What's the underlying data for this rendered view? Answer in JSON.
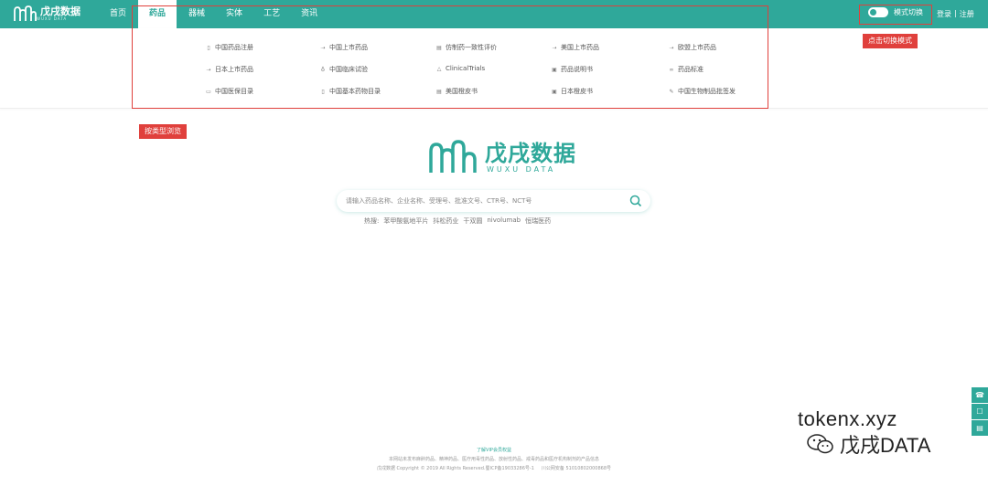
{
  "header": {
    "logo_text": "戊戌数据",
    "logo_sub": "WUXU DATA",
    "nav": [
      "首页",
      "药品",
      "器械",
      "实体",
      "工艺",
      "资讯"
    ],
    "active_nav": "药品",
    "mode_switch_label": "模式切换",
    "login": "登录",
    "separator": "|",
    "register": "注册",
    "accent_color": "#2fa89a"
  },
  "menu": {
    "rows": [
      [
        {
          "icon": "file-icon",
          "glyph": "▯",
          "label": "中国药品注册"
        },
        {
          "icon": "arrows-icon",
          "glyph": "⇢",
          "label": "中国上市药品"
        },
        {
          "icon": "doc-icon",
          "glyph": "▤",
          "label": "仿制药一致性评价"
        },
        {
          "icon": "arrows-icon",
          "glyph": "⇢",
          "label": "美国上市药品"
        },
        {
          "icon": "arrows-icon",
          "glyph": "⇢",
          "label": "欧盟上市药品"
        }
      ],
      [
        {
          "icon": "arrows-icon",
          "glyph": "⇢",
          "label": "日本上市药品"
        },
        {
          "icon": "stethoscope-icon",
          "glyph": "♁",
          "label": "中国临床试验"
        },
        {
          "icon": "flask-icon",
          "glyph": "△",
          "label": "ClinicalTrials"
        },
        {
          "icon": "manual-icon",
          "glyph": "▣",
          "label": "药品说明书"
        },
        {
          "icon": "link-icon",
          "glyph": "∞",
          "label": "药品标准"
        }
      ],
      [
        {
          "icon": "card-icon",
          "glyph": "▭",
          "label": "中国医保目录"
        },
        {
          "icon": "book-icon",
          "glyph": "▯",
          "label": "中国基本药物目录"
        },
        {
          "icon": "list-icon",
          "glyph": "▤",
          "label": "美国橙皮书"
        },
        {
          "icon": "calendar-icon",
          "glyph": "▣",
          "label": "日本橙皮书"
        },
        {
          "icon": "pen-icon",
          "glyph": "✎",
          "label": "中国生物制品批签发"
        }
      ]
    ]
  },
  "annotations": {
    "browse_by_type": "按类型浏览",
    "click_switch_mode": "点击切换模式",
    "color": "#e0403c"
  },
  "center": {
    "logo_text": "戊戌数据",
    "logo_sub": "WUXU DATA",
    "search_placeholder": "请输入药品名称、企业名称、受理号、批准文号、CTR号、NCT号",
    "hot_label": "热搜:",
    "hot_terms": [
      "苯甲酸氨地平片",
      "抖松药业",
      "干双圆",
      "nivolumab",
      "恒瑞医药"
    ]
  },
  "footer": {
    "vip_link": "了解VIP会员权益",
    "line2": "本网站未发布麻醉药品、精神药品、医疗用毒性药品、放射性药品、戒毒药品和医疗机构制剂的产品信息",
    "line3_left": "戊戌数据 Copyright © 2019 All Rights Reserved.蜀ICP备19033286号-1",
    "line3_right": "川公网安备 51010802000868号"
  },
  "side_tools": [
    {
      "icon": "phone-icon",
      "glyph": "☎"
    },
    {
      "icon": "chat-icon",
      "glyph": "☐"
    },
    {
      "icon": "feedback-icon",
      "glyph": "▤"
    }
  ],
  "watermark": {
    "line1": "tokenx.xyz",
    "line2": "戊戌DATA"
  }
}
